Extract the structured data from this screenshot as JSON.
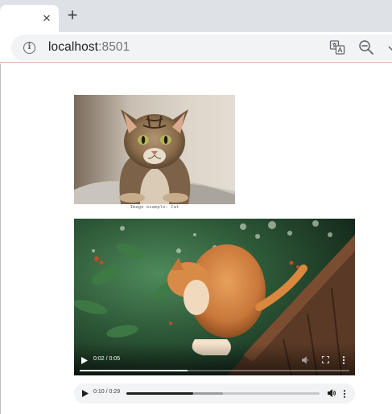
{
  "browser": {
    "tab": {
      "close_glyph": "×"
    },
    "new_tab_glyph": "+",
    "address": {
      "host": "localhost",
      "port": ":8501"
    },
    "icons": [
      "info-icon",
      "translate-icon",
      "zoom-out-icon",
      "chevron-down-icon"
    ]
  },
  "main": {
    "image": {
      "caption": "Image example: Cat"
    },
    "video": {
      "time_display": "0:02 / 0:05",
      "progress_fraction": 0.4
    },
    "audio": {
      "time_display": "0:10 / 0:29",
      "progress_fraction": 0.345,
      "buffered_fraction": 0.5
    }
  },
  "colors": {
    "tabstrip": "#dee1e6",
    "omnibox": "#f1f3f4",
    "toolbar_divider": "#e2b3a3",
    "audio_player_bg": "#f1f3f4"
  }
}
